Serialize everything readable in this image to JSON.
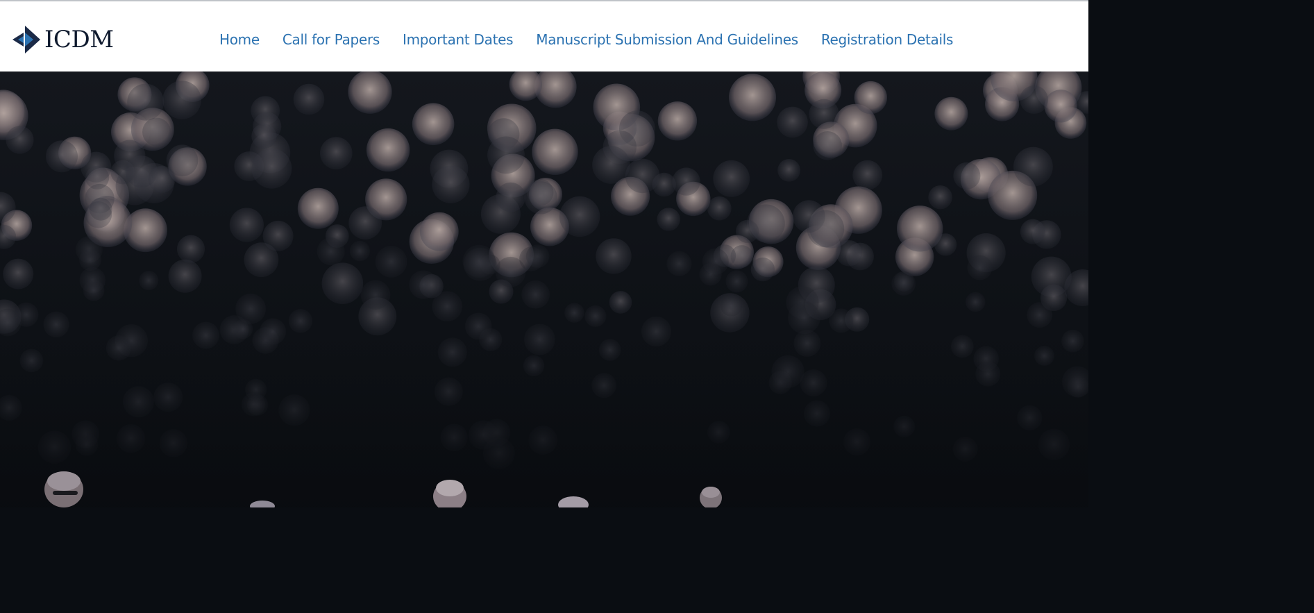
{
  "logo": {
    "text": "ICDM",
    "icon": "icdm-logo-icon",
    "colors": {
      "dark": "#1b2a47",
      "accent": "#2b72b1"
    }
  },
  "nav": {
    "items": [
      {
        "label": "Home"
      },
      {
        "label": "Call for Papers"
      },
      {
        "label": "Important Dates"
      },
      {
        "label": "Manuscript Submission And Guidelines"
      },
      {
        "label": "Registration Details"
      }
    ],
    "color": "#2b72b1"
  },
  "hero": {
    "image": "conference-audience-bokeh-lights",
    "background": "#0b0e12"
  }
}
